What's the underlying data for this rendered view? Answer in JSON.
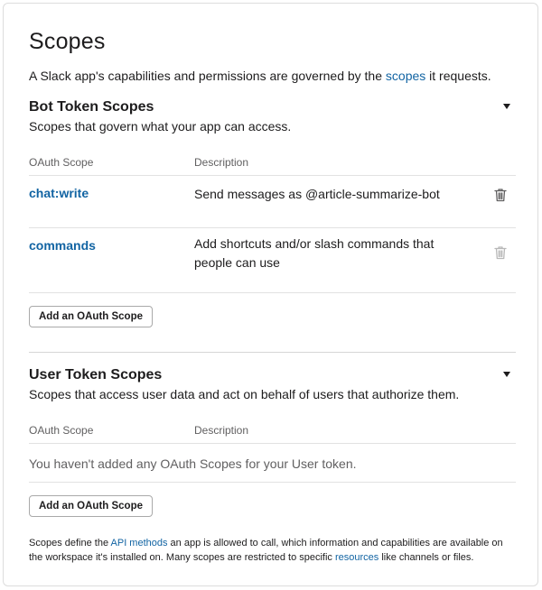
{
  "header": {
    "title": "Scopes",
    "intro_before": "A Slack app's capabilities and permissions are governed by the ",
    "intro_link": "scopes",
    "intro_after": " it requests."
  },
  "bot_section": {
    "title": "Bot Token Scopes",
    "subtitle": "Scopes that govern what your app can access.",
    "columns": {
      "scope": "OAuth Scope",
      "description": "Description"
    },
    "rows": [
      {
        "scope": "chat:write",
        "description": "Send messages as @article-summarize-bot",
        "removable": true
      },
      {
        "scope": "commands",
        "description": "Add shortcuts and/or slash commands that people can use",
        "removable": false
      }
    ],
    "add_button": "Add an OAuth Scope"
  },
  "user_section": {
    "title": "User Token Scopes",
    "subtitle": "Scopes that access user data and act on behalf of users that authorize them.",
    "columns": {
      "scope": "OAuth Scope",
      "description": "Description"
    },
    "empty_text": "You haven't added any OAuth Scopes for your User token.",
    "add_button": "Add an OAuth Scope"
  },
  "footer": {
    "text_1": "Scopes define the ",
    "link_1": "API methods",
    "text_2": " an app is allowed to call, which information and capabilities are available on the workspace it's installed on. Many scopes are restricted to specific ",
    "link_2": "resources",
    "text_3": " like channels or files."
  },
  "colors": {
    "link": "#1264a3",
    "trash_active": "#616061",
    "trash_disabled": "#b8b8b8"
  },
  "icons": {
    "collapse": "caret-down-icon",
    "remove": "trash-icon"
  }
}
